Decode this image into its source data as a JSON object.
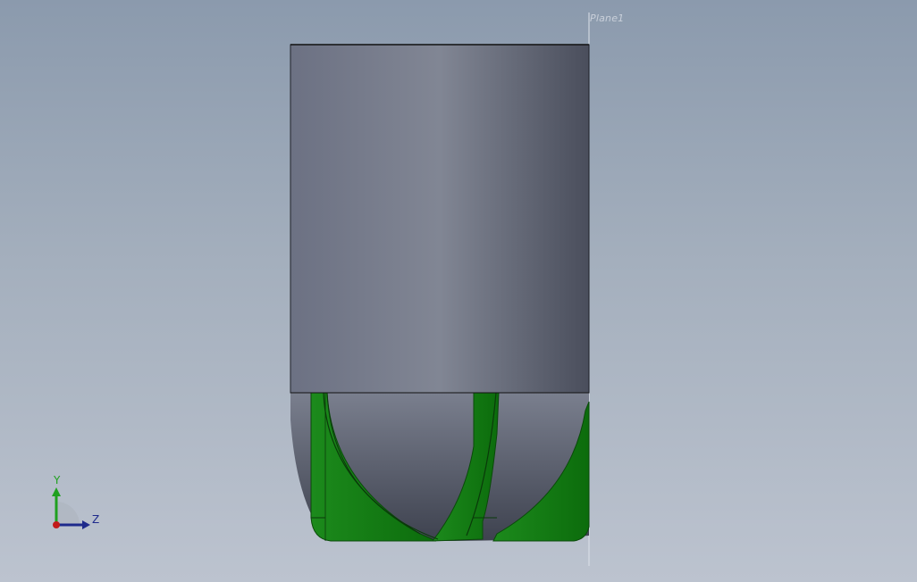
{
  "viewport": {
    "background_top": "#8b9aad",
    "background_bottom": "#bcc3cf"
  },
  "plane": {
    "label": "Plane1"
  },
  "model": {
    "body_color": "#6f7485",
    "flute_color": "#1f8f1f"
  },
  "triad": {
    "y_label": "Y",
    "z_label": "Z",
    "y_color": "#1fa01f",
    "z_color": "#1e2a8c"
  }
}
